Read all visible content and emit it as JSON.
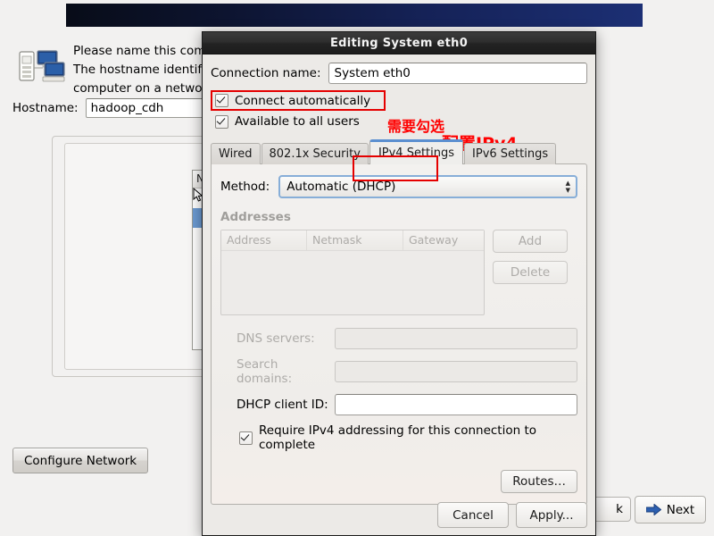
{
  "installer": {
    "info_text": "Please name this computer. The hostname identifies the computer on a network.",
    "hostname_label": "Hostname:",
    "hostname_value": "hadoop_cdh",
    "configure_network_label": "Configure Network",
    "back_label": "k",
    "next_label": "Next",
    "icon_name": "network-computers-icon",
    "next_icon": "blue-right-arrow-icon",
    "list_header": "N"
  },
  "dialog": {
    "title": "Editing System eth0",
    "connection_name_label": "Connection name:",
    "connection_name_value": "System eth0",
    "connect_automatically_label": "Connect automatically",
    "available_all_users_label": "Available to all users",
    "annotations": {
      "need_check": "需要勾选",
      "configure_ipv4": "配置IPv4"
    },
    "tabs": [
      {
        "label": "Wired",
        "active": false
      },
      {
        "label": "802.1x Security",
        "active": false
      },
      {
        "label": "IPv4 Settings",
        "active": true
      },
      {
        "label": "IPv6 Settings",
        "active": false
      }
    ],
    "ipv4": {
      "method_label": "Method:",
      "method_value": "Automatic (DHCP)",
      "addresses_label": "Addresses",
      "table_headers": [
        "Address",
        "Netmask",
        "Gateway"
      ],
      "table_rows": [],
      "add_label": "Add",
      "delete_label": "Delete",
      "dns_label": "DNS servers:",
      "dns_value": "",
      "search_domains_label": "Search domains:",
      "search_domains_value": "",
      "dhcp_client_id_label": "DHCP client ID:",
      "dhcp_client_id_value": "",
      "require_ipv4_label": "Require IPv4 addressing for this connection to complete",
      "routes_label": "Routes…"
    },
    "cancel_label": "Cancel",
    "apply_label": "Apply..."
  },
  "colors": {
    "annotation_red": "#ff0000",
    "tab_accent_blue": "#5b8fd0",
    "focus_blue": "#87aed8",
    "selection_blue": "#6b9ad2",
    "titlebar_dark": "#232323"
  }
}
